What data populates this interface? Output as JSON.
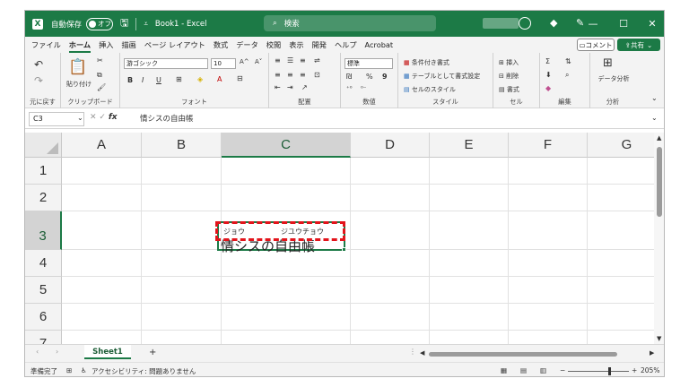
{
  "titlebar": {
    "autosave_label": "自動保存",
    "autosave_state": "オフ",
    "separator": "⩪",
    "doc_title": "Book1 - Excel",
    "search_placeholder": "検索",
    "minimize": "—",
    "restore": "☐",
    "close": "✕"
  },
  "tabs": [
    "ファイル",
    "ホーム",
    "挿入",
    "描画",
    "ページ レイアウト",
    "数式",
    "データ",
    "校閲",
    "表示",
    "開発",
    "ヘルプ",
    "Acrobat"
  ],
  "active_tab": "ホーム",
  "tab_buttons": {
    "comment": "コメント",
    "share": "共有"
  },
  "ribbon": {
    "undo_group": "元に戻す",
    "clipboard": {
      "label": "クリップボード",
      "paste": "貼り付け"
    },
    "font": {
      "label": "フォント",
      "name": "游ゴシック",
      "size": "10",
      "bold": "B",
      "italic": "I",
      "underline": "U",
      "grow": "A^",
      "shrink": "A˅"
    },
    "align": {
      "label": "配置"
    },
    "number": {
      "label": "数値",
      "format": "標準",
      "percent": "%",
      "comma": "9"
    },
    "styles": {
      "label": "スタイル",
      "cond": "条件付き書式",
      "table": "テーブルとして書式設定",
      "cell": "セルのスタイル"
    },
    "cells": {
      "label": "セル",
      "insert": "挿入",
      "delete": "削除",
      "format": "書式"
    },
    "edit": {
      "label": "編集"
    },
    "analysis": {
      "label": "分析",
      "data_analysis": "データ分析"
    }
  },
  "formula_bar": {
    "name_box": "C3",
    "fx": "fx",
    "formula": "情シスの自由帳"
  },
  "grid": {
    "columns": [
      "A",
      "B",
      "C",
      "D",
      "E",
      "F",
      "G"
    ],
    "rows": [
      "1",
      "2",
      "3",
      "4",
      "5",
      "6",
      "7"
    ],
    "selected_col": "C",
    "selected_row": "3",
    "cell_c3": {
      "furigana_1": "ジョウ",
      "furigana_2": "ジユウチョウ",
      "value": "情シスの自由帳"
    }
  },
  "sheet_tabs": {
    "sheet1": "Sheet1",
    "add": "+"
  },
  "status": {
    "ready": "準備完了",
    "accessibility": "アクセシビリティ: 問題ありません",
    "zoom": "205%"
  },
  "colors": {
    "accent": "#1c7a46",
    "highlight": "#e3141b"
  }
}
